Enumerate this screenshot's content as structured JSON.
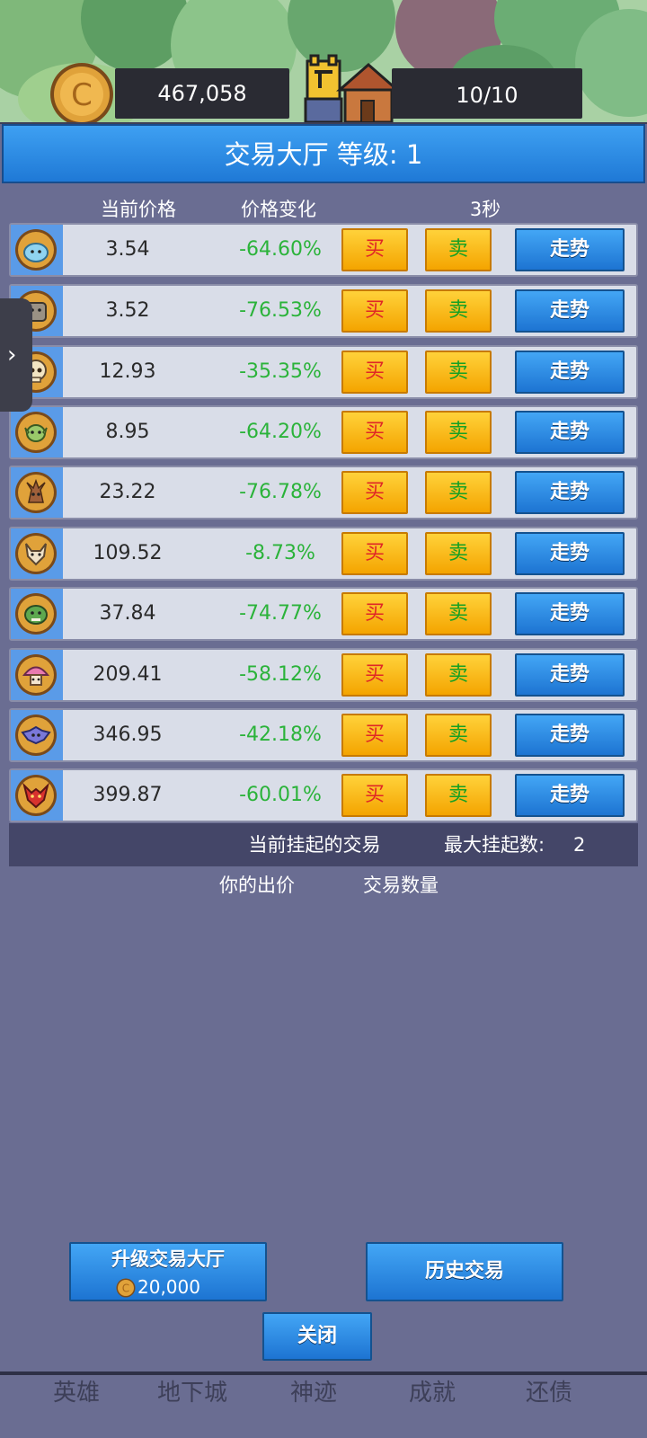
{
  "hud": {
    "coins": "467,058",
    "capacity": "10/10"
  },
  "panel": {
    "title": "交易大厅 等级: 1",
    "columns": {
      "price": "当前价格",
      "change": "价格变化",
      "timer": "3秒"
    }
  },
  "rows": [
    {
      "icon": "blue-slime-icon",
      "price": "3.54",
      "change": "-64.60%",
      "buy": "买",
      "sell": "卖",
      "trend": "走势"
    },
    {
      "icon": "rock-golem-icon",
      "price": "3.52",
      "change": "-76.53%",
      "buy": "买",
      "sell": "卖",
      "trend": "走势"
    },
    {
      "icon": "skull-icon",
      "price": "12.93",
      "change": "-35.35%",
      "buy": "买",
      "sell": "卖",
      "trend": "走势"
    },
    {
      "icon": "goblin-icon",
      "price": "8.95",
      "change": "-64.20%",
      "buy": "买",
      "sell": "卖",
      "trend": "走势"
    },
    {
      "icon": "tree-monster-icon",
      "price": "23.22",
      "change": "-76.78%",
      "buy": "买",
      "sell": "卖",
      "trend": "走势"
    },
    {
      "icon": "wolf-icon",
      "price": "109.52",
      "change": "-8.73%",
      "buy": "买",
      "sell": "卖",
      "trend": "走势"
    },
    {
      "icon": "orc-icon",
      "price": "37.84",
      "change": "-74.77%",
      "buy": "买",
      "sell": "卖",
      "trend": "走势"
    },
    {
      "icon": "mushroom-icon",
      "price": "209.41",
      "change": "-58.12%",
      "buy": "买",
      "sell": "卖",
      "trend": "走势"
    },
    {
      "icon": "bat-monster-icon",
      "price": "346.95",
      "change": "-42.18%",
      "buy": "买",
      "sell": "卖",
      "trend": "走势"
    },
    {
      "icon": "dragon-icon",
      "price": "399.87",
      "change": "-60.01%",
      "buy": "买",
      "sell": "卖",
      "trend": "走势"
    }
  ],
  "pending": {
    "title": "当前挂起的交易",
    "max_label": "最大挂起数:",
    "max_value": "2",
    "your_bid": "你的出价",
    "quantity": "交易数量"
  },
  "buttons": {
    "upgrade_label": "升级交易大厅",
    "upgrade_cost": "20,000",
    "history": "历史交易",
    "close": "关闭"
  },
  "nav": [
    "英雄",
    "地下城",
    "神迹",
    "成就",
    "还债"
  ],
  "side_tab": {
    "icon": "chevron-right-icon",
    "glyph": "›"
  },
  "colors": {
    "accent_blue": "#1f79d6",
    "buy_text": "#e02626",
    "sell_text": "#16a023",
    "change_green": "#2bb33a",
    "gold_button": "#f4a400"
  }
}
